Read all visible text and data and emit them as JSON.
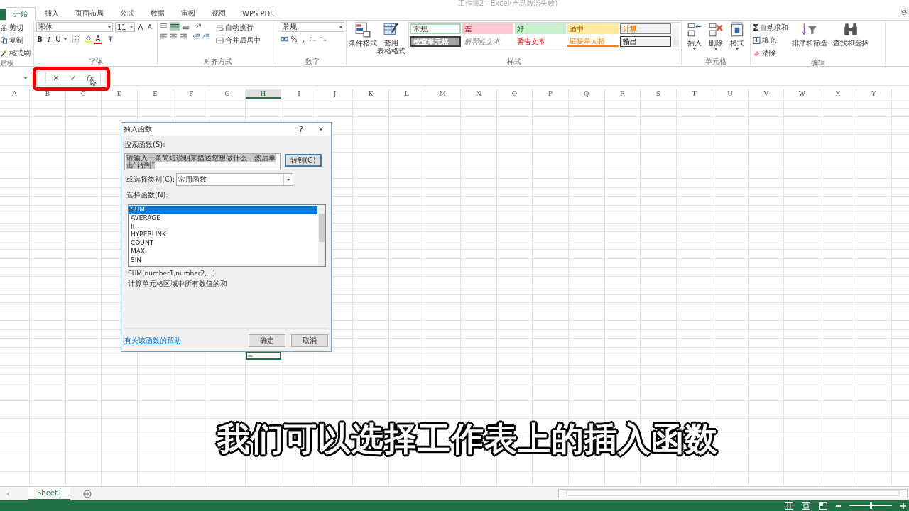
{
  "window": {
    "title": "工作簿2 - Excel(产品激活失败)"
  },
  "tabs": [
    {
      "label": "开始",
      "selected": true
    },
    {
      "label": "插入",
      "selected": false
    },
    {
      "label": "页面布局",
      "selected": false
    },
    {
      "label": "公式",
      "selected": false
    },
    {
      "label": "数据",
      "selected": false
    },
    {
      "label": "审阅",
      "selected": false
    },
    {
      "label": "视图",
      "selected": false
    },
    {
      "label": "WPS PDF",
      "selected": false
    }
  ],
  "account": "登",
  "clipboard": {
    "label": "贴板",
    "items": [
      "剪切",
      "复制",
      "格式刷"
    ]
  },
  "font": {
    "label": "字体",
    "name": "宋体",
    "size": "11",
    "grow": "A",
    "shrink": "A",
    "bold": "B",
    "italic": "I",
    "underline": "U",
    "color_letter": "A"
  },
  "alignment": {
    "label": "对齐方式",
    "wrap": "自动换行",
    "merge": "合并后居中"
  },
  "number": {
    "label": "数字",
    "format": "常规",
    "percent": "%",
    "comma": ","
  },
  "styles": {
    "label": "样式",
    "conditional": "条件格式",
    "table_format": [
      "套用",
      "表格格式"
    ],
    "cell_styles": [
      {
        "text": "常规",
        "kind": "normal"
      },
      {
        "text": "差",
        "kind": "bad"
      },
      {
        "text": "好",
        "kind": "good"
      },
      {
        "text": "适中",
        "kind": "neutral"
      },
      {
        "text": "计算",
        "kind": "calculation"
      },
      {
        "text": "检查单元格",
        "kind": "check"
      },
      {
        "text": "解释性文本",
        "kind": "explanatory"
      },
      {
        "text": "警告文本",
        "kind": "warning"
      },
      {
        "text": "链接单元格",
        "kind": "linked"
      },
      {
        "text": "输出",
        "kind": "output"
      }
    ]
  },
  "cells": {
    "label": "单元格",
    "buttons": [
      "插入",
      "删除",
      "格式"
    ]
  },
  "editing": {
    "label": "编辑",
    "autosum_symbol": "Σ",
    "autosum": "自动求和",
    "fill": "填充",
    "clear": "清除",
    "sort": "排序和筛选",
    "find": "查找和选择"
  },
  "formula_bar": {
    "cancel": "✕",
    "enter": "✓",
    "insert_function": "fx"
  },
  "columns": [
    {
      "label": "A",
      "selected": false
    },
    {
      "label": "B",
      "selected": false
    },
    {
      "label": "C",
      "selected": false
    },
    {
      "label": "D",
      "selected": false
    },
    {
      "label": "E",
      "selected": false
    },
    {
      "label": "F",
      "selected": false
    },
    {
      "label": "G",
      "selected": false
    },
    {
      "label": "H",
      "selected": true
    },
    {
      "label": "I",
      "selected": false
    },
    {
      "label": "J",
      "selected": false
    },
    {
      "label": "K",
      "selected": false
    },
    {
      "label": "L",
      "selected": false
    },
    {
      "label": "M",
      "selected": false
    },
    {
      "label": "N",
      "selected": false
    },
    {
      "label": "O",
      "selected": false
    },
    {
      "label": "P",
      "selected": false
    },
    {
      "label": "Q",
      "selected": false
    },
    {
      "label": "R",
      "selected": false
    },
    {
      "label": "S",
      "selected": false
    },
    {
      "label": "T",
      "selected": false
    },
    {
      "label": "U",
      "selected": false
    },
    {
      "label": "V",
      "selected": false
    },
    {
      "label": "W",
      "selected": false
    },
    {
      "label": "X",
      "selected": false
    },
    {
      "label": "Y",
      "selected": false
    }
  ],
  "active_cell": {
    "value": "="
  },
  "dialog": {
    "title": "插入函数",
    "help": "?",
    "close": "✕",
    "search_label": "搜索函数(S):",
    "search_value": "请输入一条简短说明来描述您想做什么，然后单击“转到”",
    "go": "转到(G)",
    "category_label": "或选择类别(C):",
    "category": "常用函数",
    "function_label": "选择函数(N):",
    "functions": [
      {
        "name": "SUM",
        "selected": true
      },
      {
        "name": "AVERAGE",
        "selected": false
      },
      {
        "name": "IF",
        "selected": false
      },
      {
        "name": "HYPERLINK",
        "selected": false
      },
      {
        "name": "COUNT",
        "selected": false
      },
      {
        "name": "MAX",
        "selected": false
      },
      {
        "name": "SIN",
        "selected": false
      }
    ],
    "signature": "SUM(number1,number2,...)",
    "description": "计算单元格区域中所有数值的和",
    "help_link": "有关该函数的帮助",
    "ok": "确定",
    "cancel": "取消"
  },
  "sheet_tabs": [
    {
      "label": "Sheet1",
      "selected": true
    }
  ],
  "zoom": {
    "level": 0.5
  },
  "subtitle": "我们可以选择工作表上的插入函数"
}
